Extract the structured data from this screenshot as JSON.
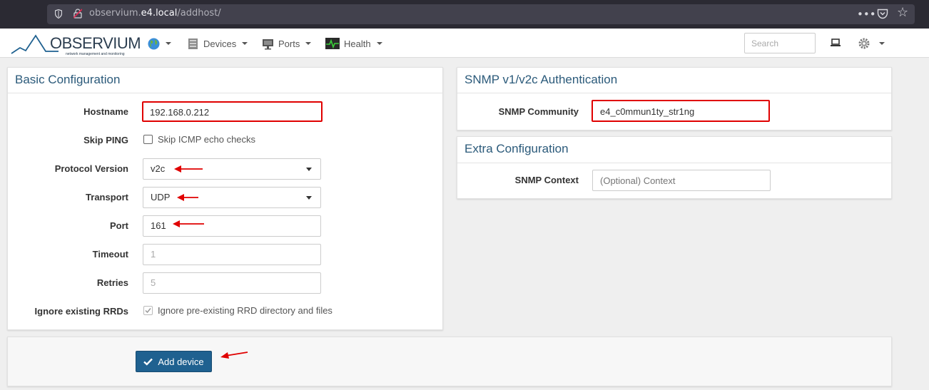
{
  "browser": {
    "url_prefix": "observium.",
    "url_host": "e4.local",
    "url_path": "/addhost/",
    "icons": [
      "shield-icon",
      "lock-icon",
      "more-icon",
      "pocket-icon",
      "bookmark-star-icon"
    ]
  },
  "navbar": {
    "logo_text": "OBSERVIUM",
    "logo_tagline": "network management and monitoring",
    "items": [
      {
        "label": "",
        "icon": "globe-icon"
      },
      {
        "label": "Devices",
        "icon": "server-icon"
      },
      {
        "label": "Ports",
        "icon": "network-port-icon"
      },
      {
        "label": "Health",
        "icon": "heartbeat-icon"
      }
    ],
    "search_placeholder": "Search",
    "right_icons": [
      "laptop-icon",
      "gear-icon"
    ]
  },
  "basic": {
    "title": "Basic Configuration",
    "hostname_label": "Hostname",
    "hostname_value": "192.168.0.212",
    "skip_ping_label": "Skip PING",
    "skip_ping_text": "Skip ICMP echo checks",
    "protocol_label": "Protocol Version",
    "protocol_value": "v2c",
    "transport_label": "Transport",
    "transport_value": "UDP",
    "port_label": "Port",
    "port_value": "161",
    "timeout_label": "Timeout",
    "timeout_value": "1",
    "retries_label": "Retries",
    "retries_value": "5",
    "ignore_rrd_label": "Ignore existing RRDs",
    "ignore_rrd_text": "Ignore pre-existing RRD directory and files"
  },
  "snmp": {
    "title": "SNMP v1/v2c Authentication",
    "community_label": "SNMP Community",
    "community_value": "e4_c0mmun1ty_str1ng"
  },
  "extra": {
    "title": "Extra Configuration",
    "context_label": "SNMP Context",
    "context_placeholder": "(Optional) Context"
  },
  "actions": {
    "add_device_label": "Add device"
  },
  "colors": {
    "accent": "#1f6190",
    "panel_title": "#2b5a7a",
    "annotation_red": "#e00000"
  }
}
